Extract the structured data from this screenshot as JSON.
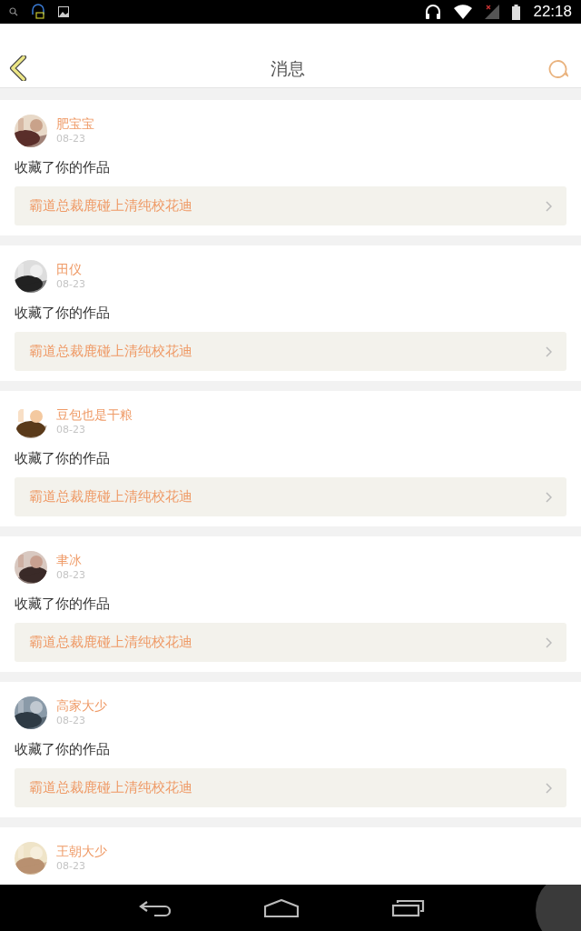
{
  "status_bar": {
    "time": "22:18"
  },
  "header": {
    "title": "消息"
  },
  "messages": [
    {
      "name": "肥宝宝",
      "date": "08-23",
      "action": "收藏了你的作品",
      "work": "霸道总裁鹿碰上清纯校花迪"
    },
    {
      "name": "田仪",
      "date": "08-23",
      "action": "收藏了你的作品",
      "work": "霸道总裁鹿碰上清纯校花迪"
    },
    {
      "name": "豆包也是干粮",
      "date": "08-23",
      "action": "收藏了你的作品",
      "work": "霸道总裁鹿碰上清纯校花迪"
    },
    {
      "name": "聿冰",
      "date": "08-23",
      "action": "收藏了你的作品",
      "work": "霸道总裁鹿碰上清纯校花迪"
    },
    {
      "name": "高家大少",
      "date": "08-23",
      "action": "收藏了你的作品",
      "work": "霸道总裁鹿碰上清纯校花迪"
    },
    {
      "name": "王朝大少",
      "date": "08-23"
    }
  ]
}
